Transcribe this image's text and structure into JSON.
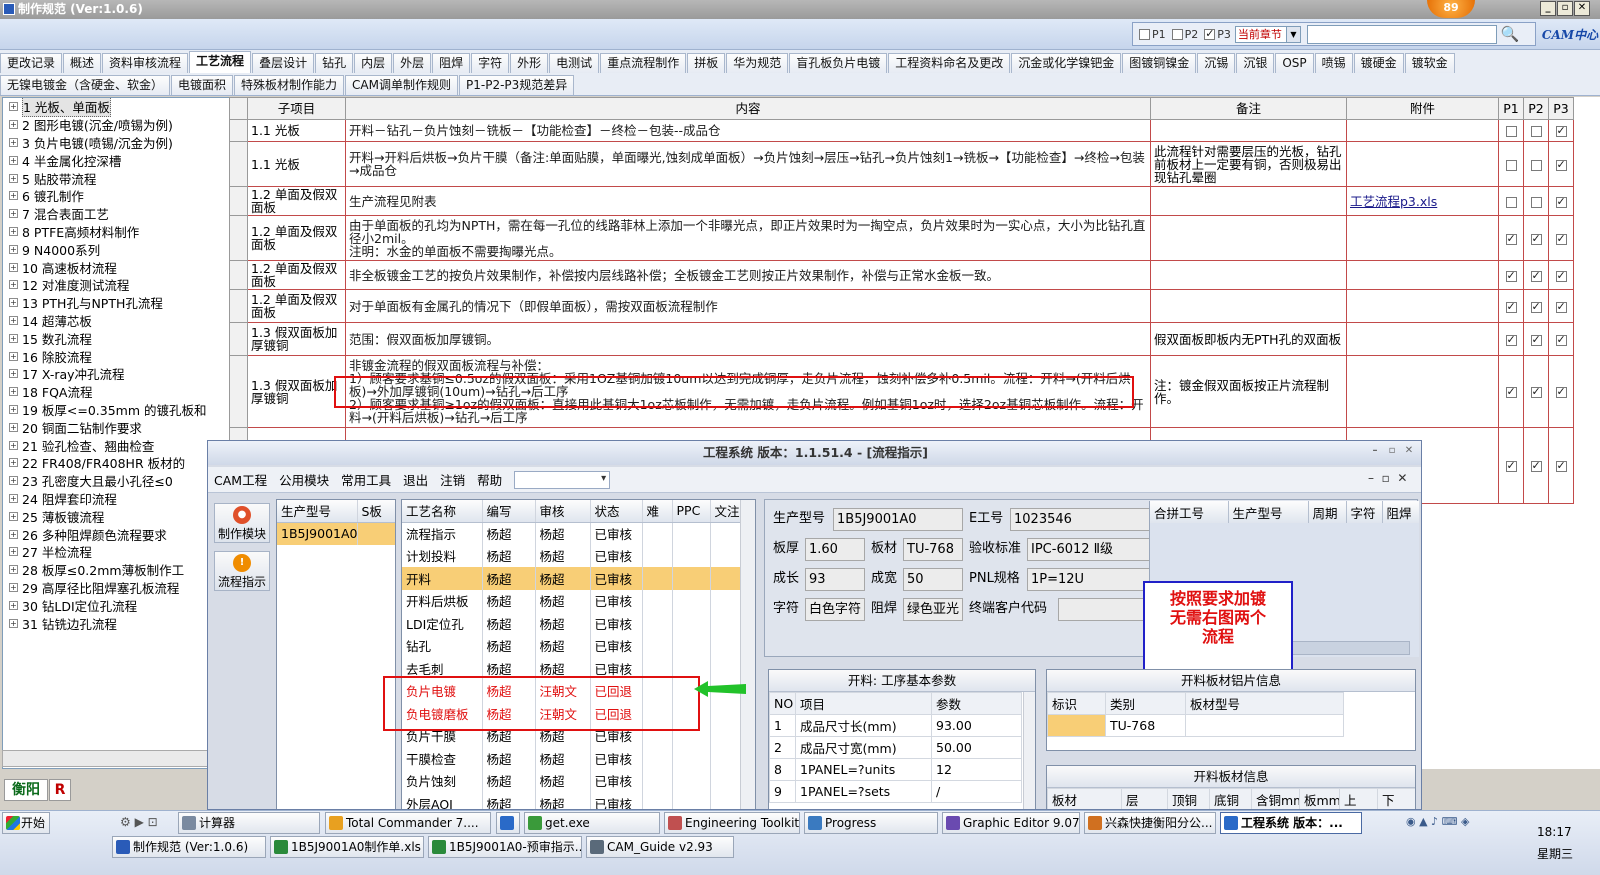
{
  "window": {
    "title": "制作规范 (Ver:1.0.6)",
    "badge": "89"
  },
  "search": {
    "p_labels": [
      "P1",
      "P2",
      "P3"
    ],
    "p_checked": [
      false,
      false,
      true
    ],
    "scope": "当前章节",
    "input_value": "",
    "logo": "CAM中心"
  },
  "tabs": {
    "row1": [
      "更改记录",
      "概述",
      "资料审核流程",
      "工艺流程",
      "叠层设计",
      "钻孔",
      "内层",
      "外层",
      "阻焊",
      "字符",
      "外形",
      "电测试",
      "重点流程制作",
      "拼板",
      "华为规范",
      "盲孔板负片电镀",
      "工程资料命名及更改",
      "沉金或化学镍钯金",
      "图镀铜镍金",
      "沉锡",
      "沉银",
      "OSP",
      "喷锡",
      "镀硬金",
      "镀软金"
    ],
    "row2": [
      "无镍电镀金（含硬金、软金）",
      "电镀面积",
      "特殊板材制作能力",
      "CAM调单制作规则",
      "P1-P2-P3规范差异"
    ],
    "active": "工艺流程"
  },
  "tree": [
    "1 光板、单面板",
    "2 图形电镀(沉金/喷锡为例)",
    "3 负片电镀(喷锡/沉金为例)",
    "4 半金属化控深槽",
    "5 贴胶带流程",
    "6 镀孔制作",
    "7 混合表面工艺",
    "8 PTFE高频材料制作",
    "9 N4000系列",
    "10 高速板材流程",
    "12 对准度测试流程",
    "13 PTH孔与NPTH孔流程",
    "14 超薄芯板",
    "15 数孔流程",
    "16 除胶流程",
    "17 X-ray冲孔流程",
    "18 FQA流程",
    "19 板厚<=0.35mm 的镀孔板和",
    "20 铜面二钻制作要求",
    "21 验孔检查、翘曲检查",
    "22 FR408/FR408HR 板材的",
    "23 孔密度大且最小孔径≤0",
    "24 阻焊套印流程",
    "25 薄板镀流程",
    "26 多种阻焊颜色流程要求",
    "27 半检流程",
    "28 板厚≤0.2mm薄板制作工",
    "29 高厚径比阻焊塞孔板流程",
    "30 钻LDI定位孔流程",
    "31 钻铣边孔流程"
  ],
  "quick": {
    "city": "衡阳",
    "r": "R"
  },
  "grid": {
    "headers": [
      "子项目",
      "内容",
      "备注",
      "附件",
      "P1",
      "P2",
      "P3"
    ],
    "rows": [
      {
        "sub": "1.1 光板",
        "content": "开料－钻孔－负片蚀刻－铣板－【功能检查】－终检－包装--成品仓",
        "note": "",
        "att": "",
        "p": [
          false,
          false,
          true
        ]
      },
      {
        "sub": "1.1 光板",
        "content": "开料→开料后烘板→负片干膜（备注:单面贴膜，单面曝光,蚀刻成单面板）→负片蚀刻→层压→钻孔→负片蚀刻1→铣板→【功能检查】→终检→包装→成品仓",
        "note": "此流程针对需要层压的光板，钻孔前板材上一定要有铜，否则极易出现钻孔晕圈",
        "att": "",
        "p": [
          false,
          false,
          true
        ]
      },
      {
        "sub": "1.2 单面及假双面板",
        "content": "生产流程见附表",
        "note": "",
        "att": "工艺流程p3.xls",
        "p": [
          false,
          false,
          true
        ]
      },
      {
        "sub": "1.2 单面及假双面板",
        "content": "由于单面板的孔均为NPTH，需在每一孔位的线路菲林上添加一个非曝光点，即正片效果时为一掏空点，负片效果时为一实心点，大小为比钻孔直径小2mil。\n注明：水金的单面板不需要掏曝光点。",
        "note": "",
        "att": "",
        "p": [
          true,
          true,
          true
        ]
      },
      {
        "sub": "1.2 单面及假双面板",
        "content": "非全板镀金工艺的按负片效果制作，补偿按内层线路补偿；全板镀金工艺则按正片效果制作，补偿与正常水金板一致。",
        "note": "",
        "att": "",
        "p": [
          true,
          true,
          true
        ]
      },
      {
        "sub": "1.2 单面及假双面板",
        "content": "对于单面板有金属孔的情况下（即假单面板），需按双面板流程制作",
        "note": "",
        "att": "",
        "p": [
          true,
          true,
          true
        ]
      },
      {
        "sub": "1.3 假双面板加厚镀铜",
        "content": "范围：假双面板加厚镀铜。",
        "note": "假双面板即板内无PTH孔的双面板",
        "att": "",
        "p": [
          true,
          true,
          true
        ]
      },
      {
        "sub": "1.3 假双面板加厚镀铜",
        "content": "非镀金流程的假双面板流程与补偿：\n1）顾客要求基铜≤0.5oz的假双面板：采用1OZ基铜加镀10um以达到完成铜厚，走负片流程，蚀刻补偿多补0.5mil。流程：开料→(开料后烘板)→外加厚镀铜(10um)→钻孔→后工序\n2）顾客要求基铜≥1oz的假双面板：直接用此基铜大1oz芯板制作，无需加镀，走负片流程。例如基铜1oz时，选择2oz基铜芯板制作。流程：开料→(开料后烘板)→钻孔→后工序",
        "note": "注：镀金假双面板按正片流程制作。",
        "att": "",
        "p": [
          true,
          true,
          true
        ]
      },
      {
        "sub": "",
        "content": "",
        "note": "",
        "att": "",
        "p": [
          true,
          true,
          true
        ]
      }
    ]
  },
  "sub": {
    "title": "工程系统  版本：1.1.51.4 - [流程指示]",
    "menu": [
      "CAM工程",
      "公用模块",
      "常用工具",
      "退出",
      "注销",
      "帮助"
    ],
    "side_buttons": [
      "制作模块",
      "流程指示"
    ],
    "list_headers": [
      "生产型号",
      "S板"
    ],
    "list_rows": [
      [
        "1B5J9001A0",
        ""
      ]
    ],
    "proc_headers": [
      "工艺名称",
      "编写",
      "审核",
      "状态",
      "难",
      "PPC",
      "文注"
    ],
    "proc_rows": [
      [
        "流程指示",
        "杨超",
        "杨超",
        "已审核"
      ],
      [
        "计划投料",
        "杨超",
        "杨超",
        "已审核"
      ],
      [
        "开料",
        "杨超",
        "杨超",
        "已审核"
      ],
      [
        "开料后烘板",
        "杨超",
        "杨超",
        "已审核"
      ],
      [
        "LDI定位孔",
        "杨超",
        "杨超",
        "已审核"
      ],
      [
        "钻孔",
        "杨超",
        "杨超",
        "已审核"
      ],
      [
        "去毛刺",
        "杨超",
        "杨超",
        "已审核"
      ],
      [
        "负片电镀",
        "杨超",
        "汪朝文",
        "已回退"
      ],
      [
        "负电镀磨板",
        "杨超",
        "汪朝文",
        "已回退"
      ],
      [
        "负片干膜",
        "杨超",
        "杨超",
        "已审核"
      ],
      [
        "干膜检查",
        "杨超",
        "杨超",
        "已审核"
      ],
      [
        "负片蚀刻",
        "杨超",
        "杨超",
        "已审核"
      ],
      [
        "外层AOI",
        "杨超",
        "杨超",
        "已审核"
      ]
    ],
    "proc_highlight": 2,
    "proc_red": [
      7,
      8
    ],
    "form": {
      "prod_label": "生产型号",
      "prod": "1B5J9001A0",
      "e_label": "E工号",
      "e": "1023546",
      "thick_label": "板厚",
      "thick": "1.60",
      "mat_label": "板材",
      "mat": "TU-768",
      "std_label": "验收标准",
      "std": "IPC-6012 Ⅱ级",
      "grow_label": "成长",
      "grow": "93",
      "width_label": "成宽",
      "width": "50",
      "pnl_label": "PNL规格",
      "pnl": "1P=12U",
      "char_label": "字符",
      "char": "白色字符",
      "mask_label": "阻焊",
      "mask": "绿色亚光",
      "cust_label": "终端客户代码",
      "cust": ""
    },
    "hpanel_headers": [
      "合拼工号",
      "生产型号",
      "周期",
      "字符",
      "阻焊"
    ],
    "note": "按照要求加镀\n无需右图两个\n流程",
    "params": {
      "title": "开料: 工序基本参数",
      "headers": [
        "NO",
        "项目",
        "参数"
      ],
      "rows": [
        [
          "1",
          "成品尺寸长(mm)",
          "93.00"
        ],
        [
          "2",
          "成品尺寸宽(mm)",
          "50.00"
        ],
        [
          "8",
          "1PANEL=?units",
          "12"
        ],
        [
          "9",
          "1PANEL=?sets",
          "/"
        ]
      ]
    },
    "alum": {
      "title": "开料板材铝片信息",
      "headers": [
        "标识",
        "类别",
        "板材型号"
      ],
      "rows": [
        [
          "",
          "TU-768",
          ""
        ]
      ]
    },
    "board": {
      "title": "开料板材信息",
      "headers": [
        "板材",
        "层",
        "顶铜",
        "底铜",
        "含铜mm",
        "板mm",
        "上",
        "下"
      ]
    }
  },
  "taskbar": {
    "start": "开始",
    "row1": [
      "计算器",
      "Total Commander 7....",
      "",
      "get.exe",
      "Engineering Toolkit 9...",
      "Progress",
      "Graphic Editor 9.07b...",
      "兴森快捷衡阳分公...",
      "工程系统  版本：..."
    ],
    "row2": [
      "制作规范 (Ver:1.0.6)",
      "1B5J9001A0制作单.xls ...",
      "1B5J9001A0-预审指示....",
      "CAM_Guide v2.93"
    ],
    "time": "18:17",
    "day": "星期三"
  },
  "colors": {
    "highlight": "#e01010",
    "note_border": "#2020c8",
    "active_row": "#f8ce76",
    "arrow": "#22c22a"
  }
}
